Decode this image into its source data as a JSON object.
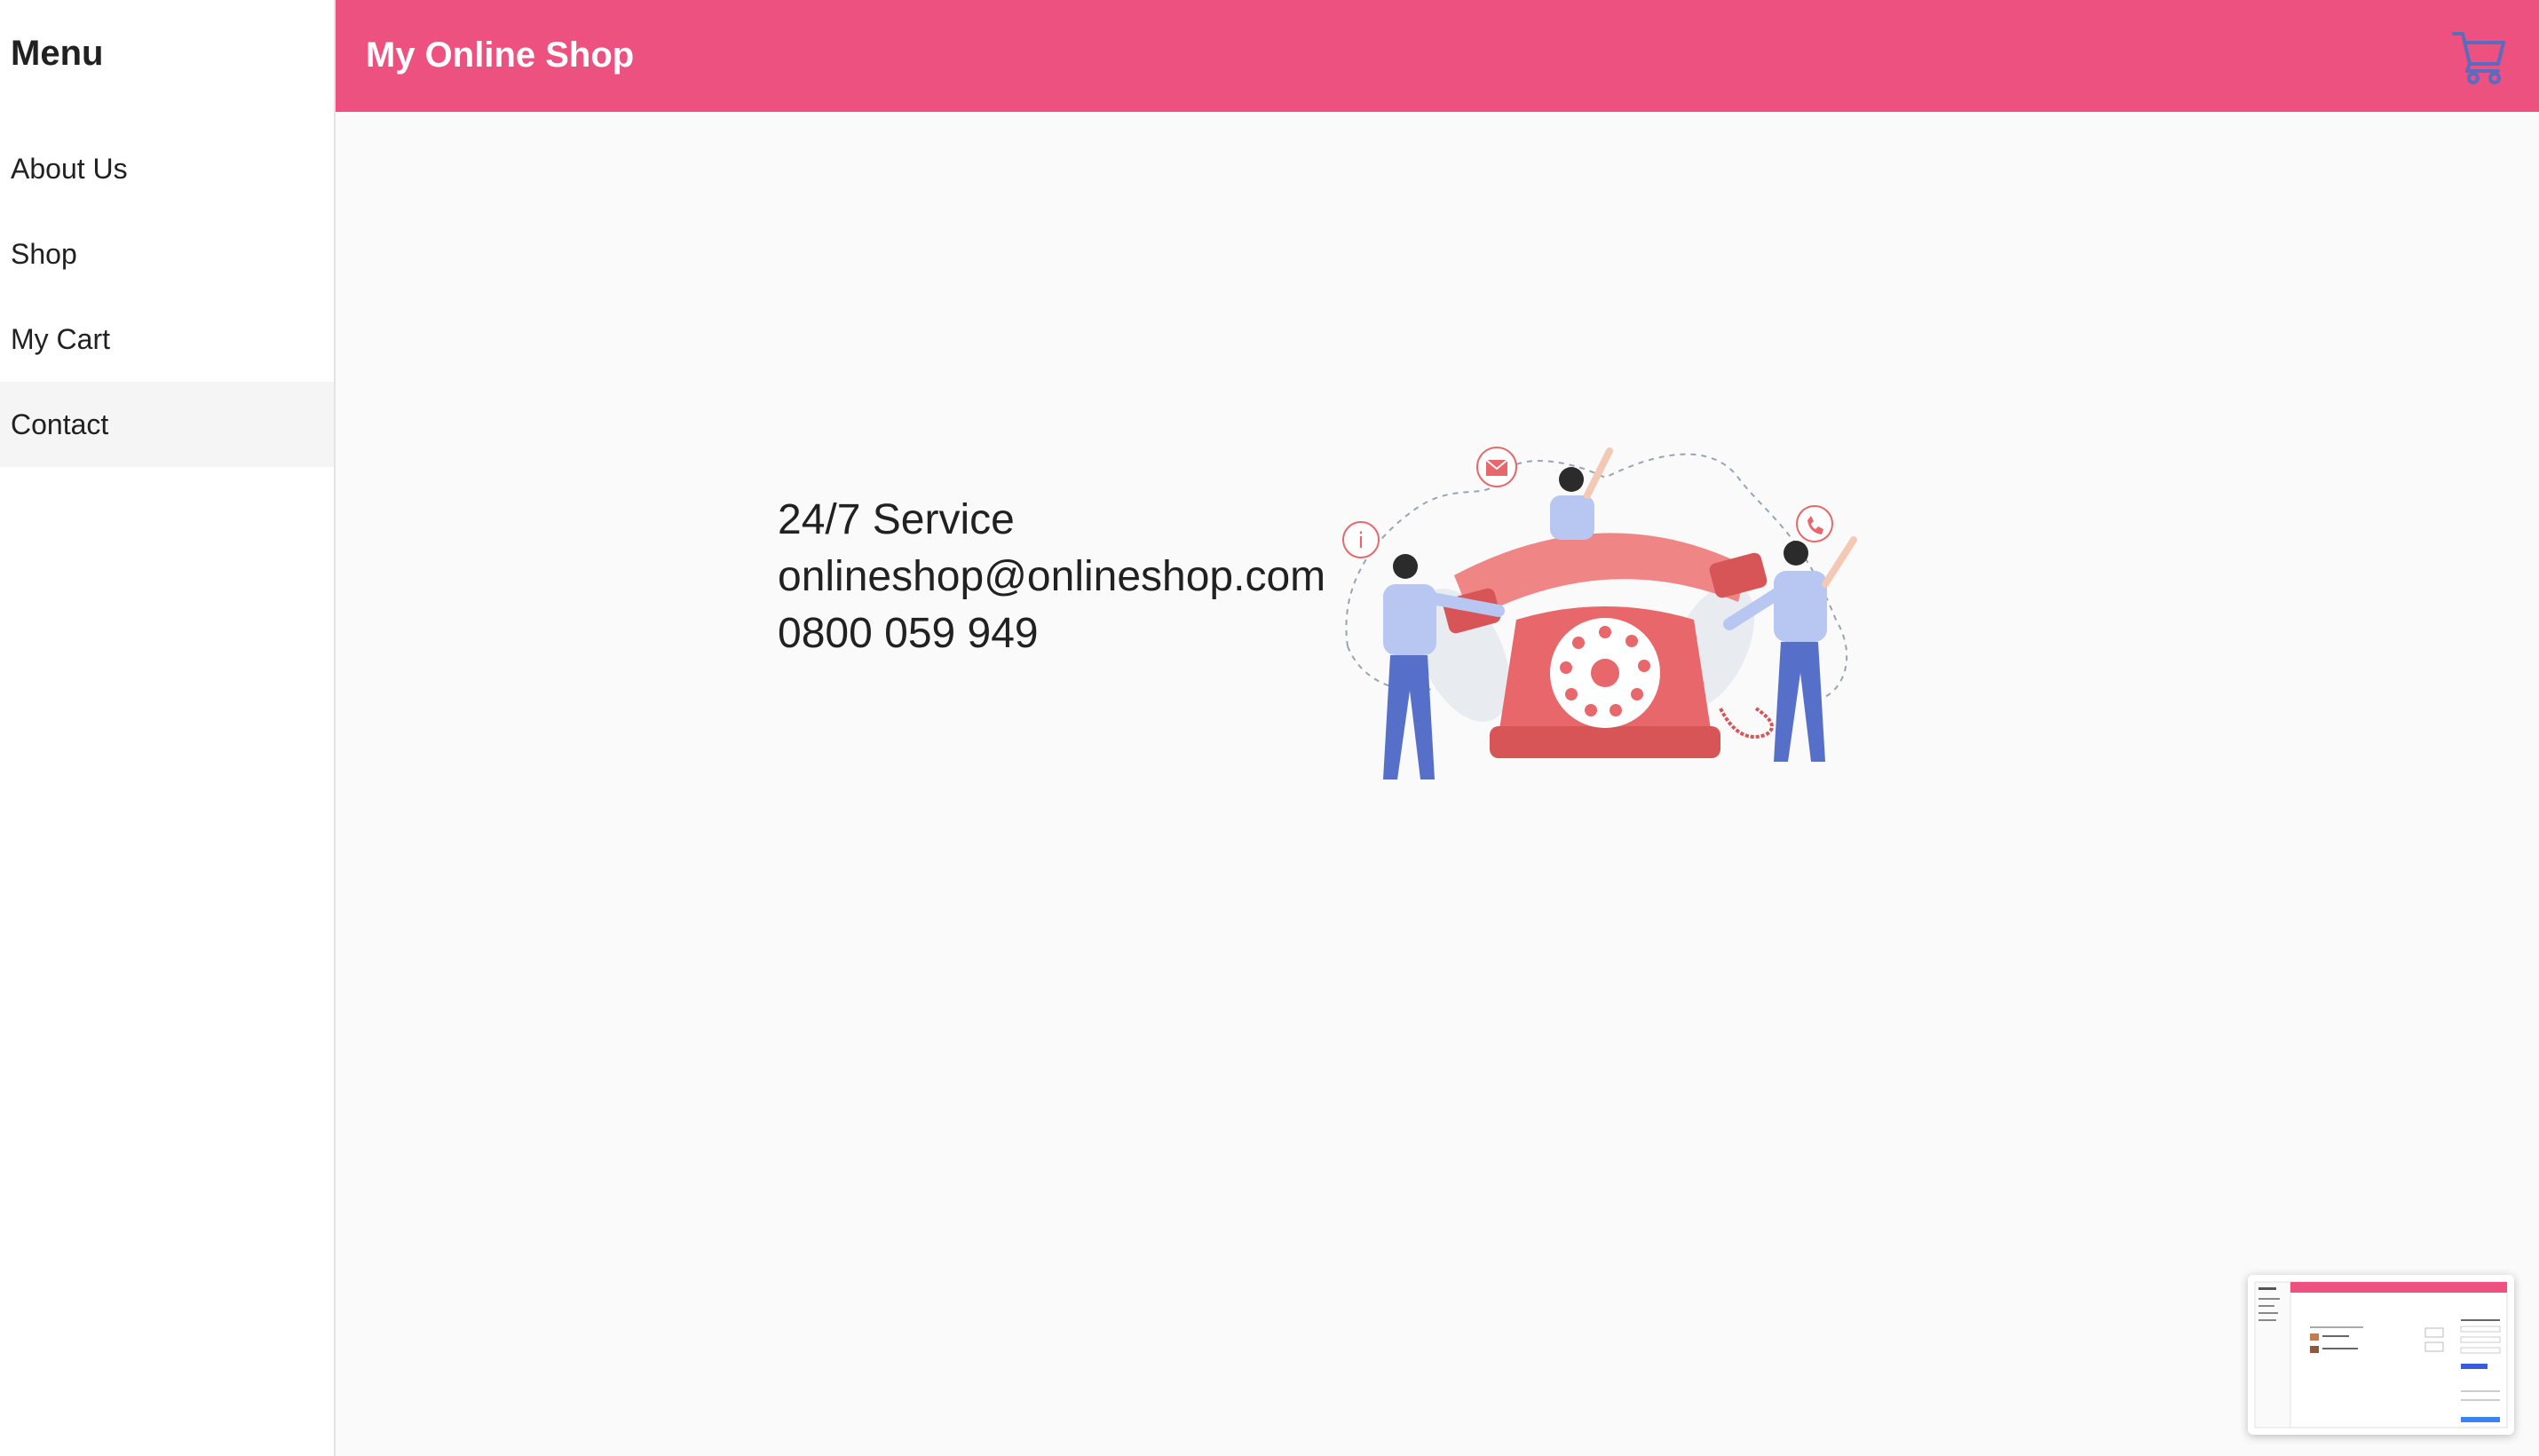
{
  "sidebar": {
    "title": "Menu",
    "items": [
      {
        "label": "About Us",
        "active": false
      },
      {
        "label": "Shop",
        "active": false
      },
      {
        "label": "My Cart",
        "active": false
      },
      {
        "label": "Contact",
        "active": true
      }
    ]
  },
  "toolbar": {
    "title": "My Online Shop",
    "cart_icon": "shopping-cart-icon",
    "background_color": "#ec5180",
    "cart_icon_color": "#5c6bc0"
  },
  "contact": {
    "service": "24/7 Service",
    "email": "onlineshop@onlineshop.com",
    "phone": "0800 059 949"
  },
  "illustration": {
    "icons": [
      "info-icon",
      "mail-icon",
      "phone-icon"
    ],
    "accent_color": "#e8676a"
  }
}
